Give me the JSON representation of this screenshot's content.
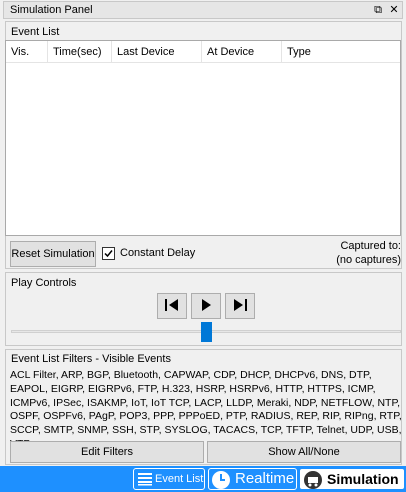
{
  "window": {
    "title": "Simulation Panel",
    "restore_glyph": "⧉",
    "close_glyph": "✕"
  },
  "event_list": {
    "label": "Event List",
    "columns": [
      "Vis.",
      "Time(sec)",
      "Last Device",
      "At Device",
      "Type"
    ],
    "rows": []
  },
  "controls": {
    "reset_label": "Reset Simulation",
    "constant_delay_label": "Constant Delay",
    "constant_delay_checked": true,
    "captured_label": "Captured to:",
    "captured_value": "(no captures)"
  },
  "play_controls": {
    "label": "Play Controls",
    "slider_fraction": 0.5
  },
  "filters": {
    "label": "Event List Filters - Visible Events",
    "protocols_text": "ACL Filter, ARP, BGP, Bluetooth, CAPWAP, CDP, DHCP, DHCPv6, DNS, DTP, EAPOL, EIGRP, EIGRPv6, FTP, H.323, HSRP, HSRPv6, HTTP, HTTPS, ICMP, ICMPv6, IPSec, ISAKMP, IoT, IoT TCP, LACP, LLDP, Meraki, NDP, NETFLOW, NTP, OSPF, OSPFv6, PAgP, POP3, PPP, PPPoED, PTP, RADIUS, REP, RIP, RIPng, RTP, SCCP, SMTP, SNMP, SSH, STP, SYSLOG, TACACS, TCP, TFTP, Telnet, UDP, USB, VTP",
    "edit_label": "Edit Filters",
    "show_all_label": "Show All/None"
  },
  "bottom_tabs": {
    "event_list_label": "Event List",
    "realtime_label": "Realtime",
    "simulation_label": "Simulation"
  },
  "colors": {
    "accent": "#1e90ff",
    "slider": "#0078d7"
  }
}
